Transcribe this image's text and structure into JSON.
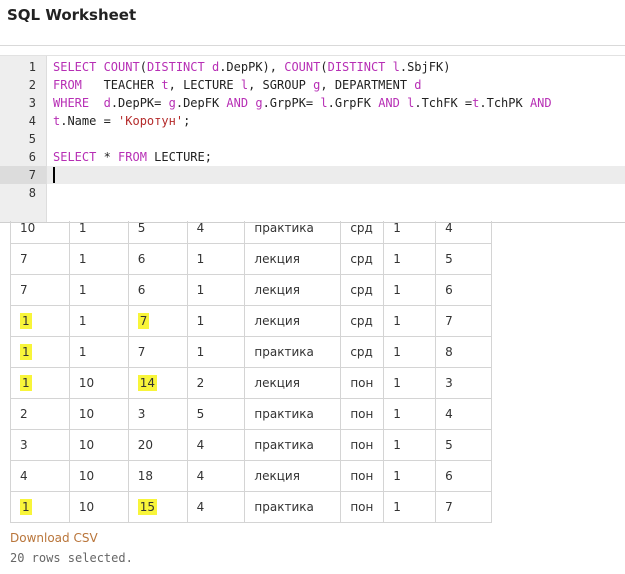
{
  "title": "SQL Worksheet",
  "editor": {
    "lines": [
      {
        "n": "1",
        "html": "<span class=\"kw\">SELECT COUNT</span>(<span class=\"kw\">DISTINCT</span> <span class=\"kw\">d</span>.DepPK), <span class=\"kw\">COUNT</span>(<span class=\"kw\">DISTINCT</span> <span class=\"kw\">l</span>.SbjFK)"
      },
      {
        "n": "2",
        "html": "<span class=\"kw\">FROM</span>   TEACHER <span class=\"kw\">t</span>, LECTURE <span class=\"kw\">l</span>, SGROUP <span class=\"kw\">g</span>, DEPARTMENT <span class=\"kw\">d</span>"
      },
      {
        "n": "3",
        "html": "<span class=\"kw\">WHERE</span>  <span class=\"kw\">d</span>.DepPK= <span class=\"kw\">g</span>.DepFK <span class=\"kw\">AND</span> <span class=\"kw\">g</span>.GrpPK= <span class=\"kw\">l</span>.GrpFK <span class=\"kw\">AND</span> <span class=\"kw\">l</span>.TchFK =<span class=\"kw\">t</span>.TchPK <span class=\"kw\">AND</span>"
      },
      {
        "n": "4",
        "html": "<span class=\"kw\">t</span>.Name = <span class=\"str\">'Коротун'</span>;"
      },
      {
        "n": "5",
        "html": ""
      },
      {
        "n": "6",
        "html": "<span class=\"kw\">SELECT</span> * <span class=\"kw\">FROM</span> LECTURE;"
      },
      {
        "n": "7",
        "html": ""
      },
      {
        "n": "8",
        "html": ""
      }
    ]
  },
  "results": {
    "rows": [
      [
        "10",
        "1",
        "5",
        "4",
        "практика",
        "срд",
        "1",
        "4"
      ],
      [
        "7",
        "1",
        "6",
        "1",
        "лекция",
        "срд",
        "1",
        "5"
      ],
      [
        "7",
        "1",
        "6",
        "1",
        "лекция",
        "срд",
        "1",
        "6"
      ],
      [
        "1",
        "1",
        "7",
        "1",
        "лекция",
        "срд",
        "1",
        "7"
      ],
      [
        "1",
        "1",
        "7",
        "1",
        "практика",
        "срд",
        "1",
        "8"
      ],
      [
        "1",
        "10",
        "14",
        "2",
        "лекция",
        "пон",
        "1",
        "3"
      ],
      [
        "2",
        "10",
        "3",
        "5",
        "практика",
        "пон",
        "1",
        "4"
      ],
      [
        "3",
        "10",
        "20",
        "4",
        "практика",
        "пон",
        "1",
        "5"
      ],
      [
        "4",
        "10",
        "18",
        "4",
        "лекция",
        "пон",
        "1",
        "6"
      ],
      [
        "1",
        "10",
        "15",
        "4",
        "практика",
        "пон",
        "1",
        "7"
      ]
    ],
    "highlighted": [
      [
        3,
        0
      ],
      [
        3,
        2
      ],
      [
        4,
        0
      ],
      [
        5,
        0
      ],
      [
        5,
        2
      ],
      [
        9,
        0
      ],
      [
        9,
        2
      ]
    ]
  },
  "download_label": "Download CSV",
  "status": "20 rows selected."
}
